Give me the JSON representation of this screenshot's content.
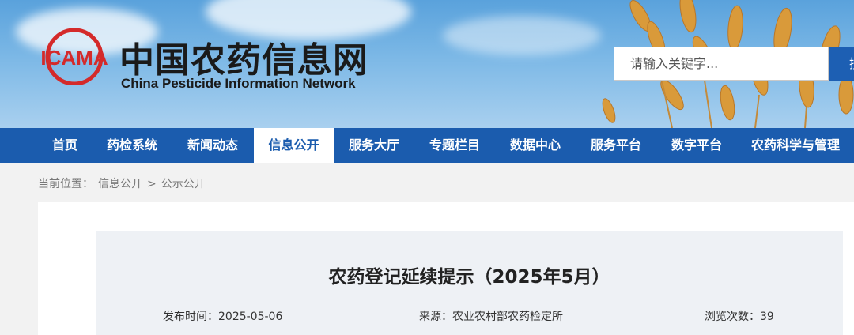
{
  "header": {
    "site_name_cn": "中国农药信息网",
    "site_name_en": "China Pesticide Information Network",
    "logo_text": "ICAMA",
    "search": {
      "placeholder": "请输入关键字...",
      "button_label": "搜索"
    }
  },
  "nav": {
    "items": [
      {
        "label": "首页"
      },
      {
        "label": "药检系统"
      },
      {
        "label": "新闻动态"
      },
      {
        "label": "信息公开"
      },
      {
        "label": "服务大厅"
      },
      {
        "label": "专题栏目"
      },
      {
        "label": "数据中心"
      },
      {
        "label": "服务平台"
      },
      {
        "label": "数字平台"
      },
      {
        "label": "农药科学与管理"
      }
    ],
    "active": "信息公开"
  },
  "breadcrumb": {
    "prefix": "当前位置：",
    "items": [
      "信息公开",
      "公示公开"
    ],
    "separator": ">"
  },
  "article": {
    "title": "农药登记延续提示（2025年5月）",
    "publish_label": "发布时间：",
    "publish_date": "2025-05-06",
    "source_label": "来源：",
    "source": "农业农村部农药检定所",
    "views_label": "浏览次数：",
    "views": "39"
  },
  "colors": {
    "nav_bg": "#1b5cae",
    "logo_red": "#d42a2a",
    "accent": "#1d5fb3"
  }
}
